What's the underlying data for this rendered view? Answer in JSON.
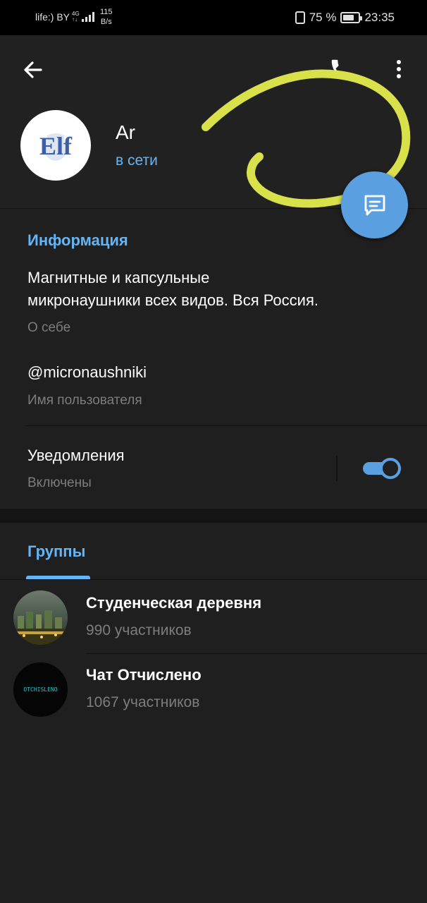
{
  "statusbar": {
    "carrier": "life:) BY",
    "network_type": "4G",
    "speed_value": "115",
    "speed_unit": "B/s",
    "battery": "75 %",
    "time": "23:35"
  },
  "header": {
    "name": "Ar",
    "status": "в сети",
    "avatar_text": "Elf",
    "icons": [
      "back-arrow",
      "phone",
      "more-vert",
      "message"
    ]
  },
  "info": {
    "title": "Информация",
    "bio_line1": "Магнитные и капсульные",
    "bio_line2": "микронаушники всех видов. Вся Россия.",
    "bio_label": "О себе",
    "username": "@micronaushniki",
    "username_label": "Имя пользователя",
    "notifications": "Уведомления",
    "notifications_state": "Включены",
    "notifications_on": true
  },
  "groups": {
    "tab_label": "Группы",
    "items": [
      {
        "name": "Студенческая деревня",
        "count": "990 участников"
      },
      {
        "name": "Чат Отчислено",
        "count": "1067 участников",
        "avatar_text": "OTCHISLENO"
      }
    ]
  },
  "colors": {
    "accent": "#64b5f6",
    "fab": "#5a9fe0",
    "background": "#1f1f1f",
    "annotation": "#d8e04a"
  }
}
